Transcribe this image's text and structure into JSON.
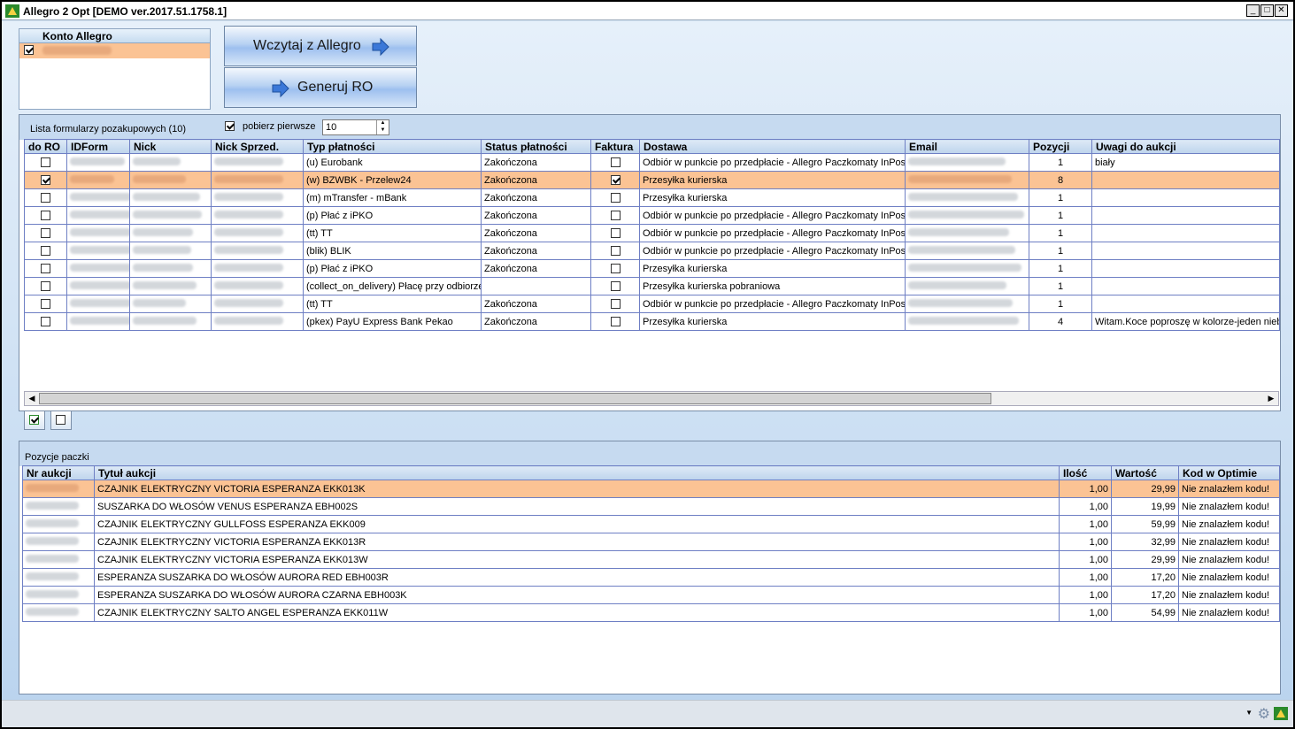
{
  "window": {
    "title": "Allegro 2 Opt [DEMO ver.2017.51.1758.1]",
    "min": "_",
    "max": "□",
    "close": "✕"
  },
  "accounts": {
    "header": "Konto Allegro",
    "rows": [
      {
        "checked": true
      }
    ]
  },
  "buttons": {
    "load": "Wczytaj z Allegro",
    "generate": "Generuj RO"
  },
  "forms": {
    "title": "Lista formularzy pozakupowych (10)",
    "fetch_first_label": "pobierz pierwsze",
    "fetch_first_checked": true,
    "fetch_first_value": "10",
    "columns": [
      "do RO",
      "IDForm",
      "Nick",
      "Nick Sprzed.",
      "Typ płatności",
      "Status płatności",
      "Faktura",
      "Dostawa",
      "Email",
      "Pozycji",
      "Uwagi do aukcji"
    ],
    "rows": [
      {
        "do_ro": false,
        "typ": "(u) Eurobank",
        "status": "Zakończona",
        "faktura": false,
        "dostawa": "Odbiór w punkcie po przedpłacie - Allegro Paczkomaty InPost",
        "pozycji": "1",
        "uwagi": "biały",
        "selected": false
      },
      {
        "do_ro": true,
        "typ": "(w) BZWBK - Przelew24",
        "status": "Zakończona",
        "faktura": true,
        "dostawa": "Przesyłka kurierska",
        "pozycji": "8",
        "uwagi": "",
        "selected": true
      },
      {
        "do_ro": false,
        "typ": "(m) mTransfer - mBank",
        "status": "Zakończona",
        "faktura": false,
        "dostawa": "Przesyłka kurierska",
        "pozycji": "1",
        "uwagi": "",
        "selected": false
      },
      {
        "do_ro": false,
        "typ": "(p) Płać z iPKO",
        "status": "Zakończona",
        "faktura": false,
        "dostawa": "Odbiór w punkcie po przedpłacie - Allegro Paczkomaty InPost",
        "pozycji": "1",
        "uwagi": "",
        "selected": false
      },
      {
        "do_ro": false,
        "typ": "(tt) TT",
        "status": "Zakończona",
        "faktura": false,
        "dostawa": "Odbiór w punkcie po przedpłacie - Allegro Paczkomaty InPost",
        "pozycji": "1",
        "uwagi": "",
        "selected": false
      },
      {
        "do_ro": false,
        "typ": "(blik) BLIK",
        "status": "Zakończona",
        "faktura": false,
        "dostawa": "Odbiór w punkcie po przedpłacie - Allegro Paczkomaty InPost",
        "pozycji": "1",
        "uwagi": "",
        "selected": false
      },
      {
        "do_ro": false,
        "typ": "(p) Płać z iPKO",
        "status": "Zakończona",
        "faktura": false,
        "dostawa": "Przesyłka kurierska",
        "pozycji": "1",
        "uwagi": "",
        "selected": false
      },
      {
        "do_ro": false,
        "typ": "(collect_on_delivery) Płacę przy odbiorze",
        "status": "",
        "faktura": false,
        "dostawa": "Przesyłka kurierska pobraniowa",
        "pozycji": "1",
        "uwagi": "",
        "selected": false
      },
      {
        "do_ro": false,
        "typ": "(tt) TT",
        "status": "Zakończona",
        "faktura": false,
        "dostawa": "Odbiór w punkcie po przedpłacie - Allegro Paczkomaty InPost",
        "pozycji": "1",
        "uwagi": "",
        "selected": false
      },
      {
        "do_ro": false,
        "typ": "(pkex) PayU Express Bank Pekao",
        "status": "Zakończona",
        "faktura": false,
        "dostawa": "Przesyłka kurierska",
        "pozycji": "4",
        "uwagi": "Witam.Koce poproszę w kolorze-jeden nieb",
        "selected": false
      }
    ]
  },
  "items": {
    "title": "Pozycje paczki",
    "columns": [
      "Nr aukcji",
      "Tytuł aukcji",
      "Ilość",
      "Wartość",
      "Kod w Optimie"
    ],
    "rows": [
      {
        "tytul": "CZAJNIK ELEKTRYCZNY VICTORIA ESPERANZA EKK013K",
        "ilosc": "1,00",
        "wartosc": "29,99",
        "kod": "Nie znalazłem kodu!",
        "selected": true
      },
      {
        "tytul": "SUSZARKA DO WŁOSÓW VENUS ESPERANZA EBH002S",
        "ilosc": "1,00",
        "wartosc": "19,99",
        "kod": "Nie znalazłem kodu!",
        "selected": false
      },
      {
        "tytul": "CZAJNIK ELEKTRYCZNY GULLFOSS ESPERANZA EKK009",
        "ilosc": "1,00",
        "wartosc": "59,99",
        "kod": "Nie znalazłem kodu!",
        "selected": false
      },
      {
        "tytul": "CZAJNIK ELEKTRYCZNY VICTORIA ESPERANZA EKK013R",
        "ilosc": "1,00",
        "wartosc": "32,99",
        "kod": "Nie znalazłem kodu!",
        "selected": false
      },
      {
        "tytul": "CZAJNIK ELEKTRYCZNY VICTORIA ESPERANZA EKK013W",
        "ilosc": "1,00",
        "wartosc": "29,99",
        "kod": "Nie znalazłem kodu!",
        "selected": false
      },
      {
        "tytul": "ESPERANZA SUSZARKA DO WŁOSÓW AURORA RED EBH003R",
        "ilosc": "1,00",
        "wartosc": "17,20",
        "kod": "Nie znalazłem kodu!",
        "selected": false
      },
      {
        "tytul": "ESPERANZA SUSZARKA DO WŁOSÓW AURORA CZARNA EBH003K",
        "ilosc": "1,00",
        "wartosc": "17,20",
        "kod": "Nie znalazłem kodu!",
        "selected": false
      },
      {
        "tytul": "CZAJNIK ELEKTRYCZNY SALTO ANGEL ESPERANZA EKK011W",
        "ilosc": "1,00",
        "wartosc": "54,99",
        "kod": "Nie znalazłem kodu!",
        "selected": false
      }
    ]
  },
  "colors": {
    "selected_row": "#fbc394",
    "grid_line": "#6e7fc4",
    "accent_arrow": "#3b78d8"
  }
}
